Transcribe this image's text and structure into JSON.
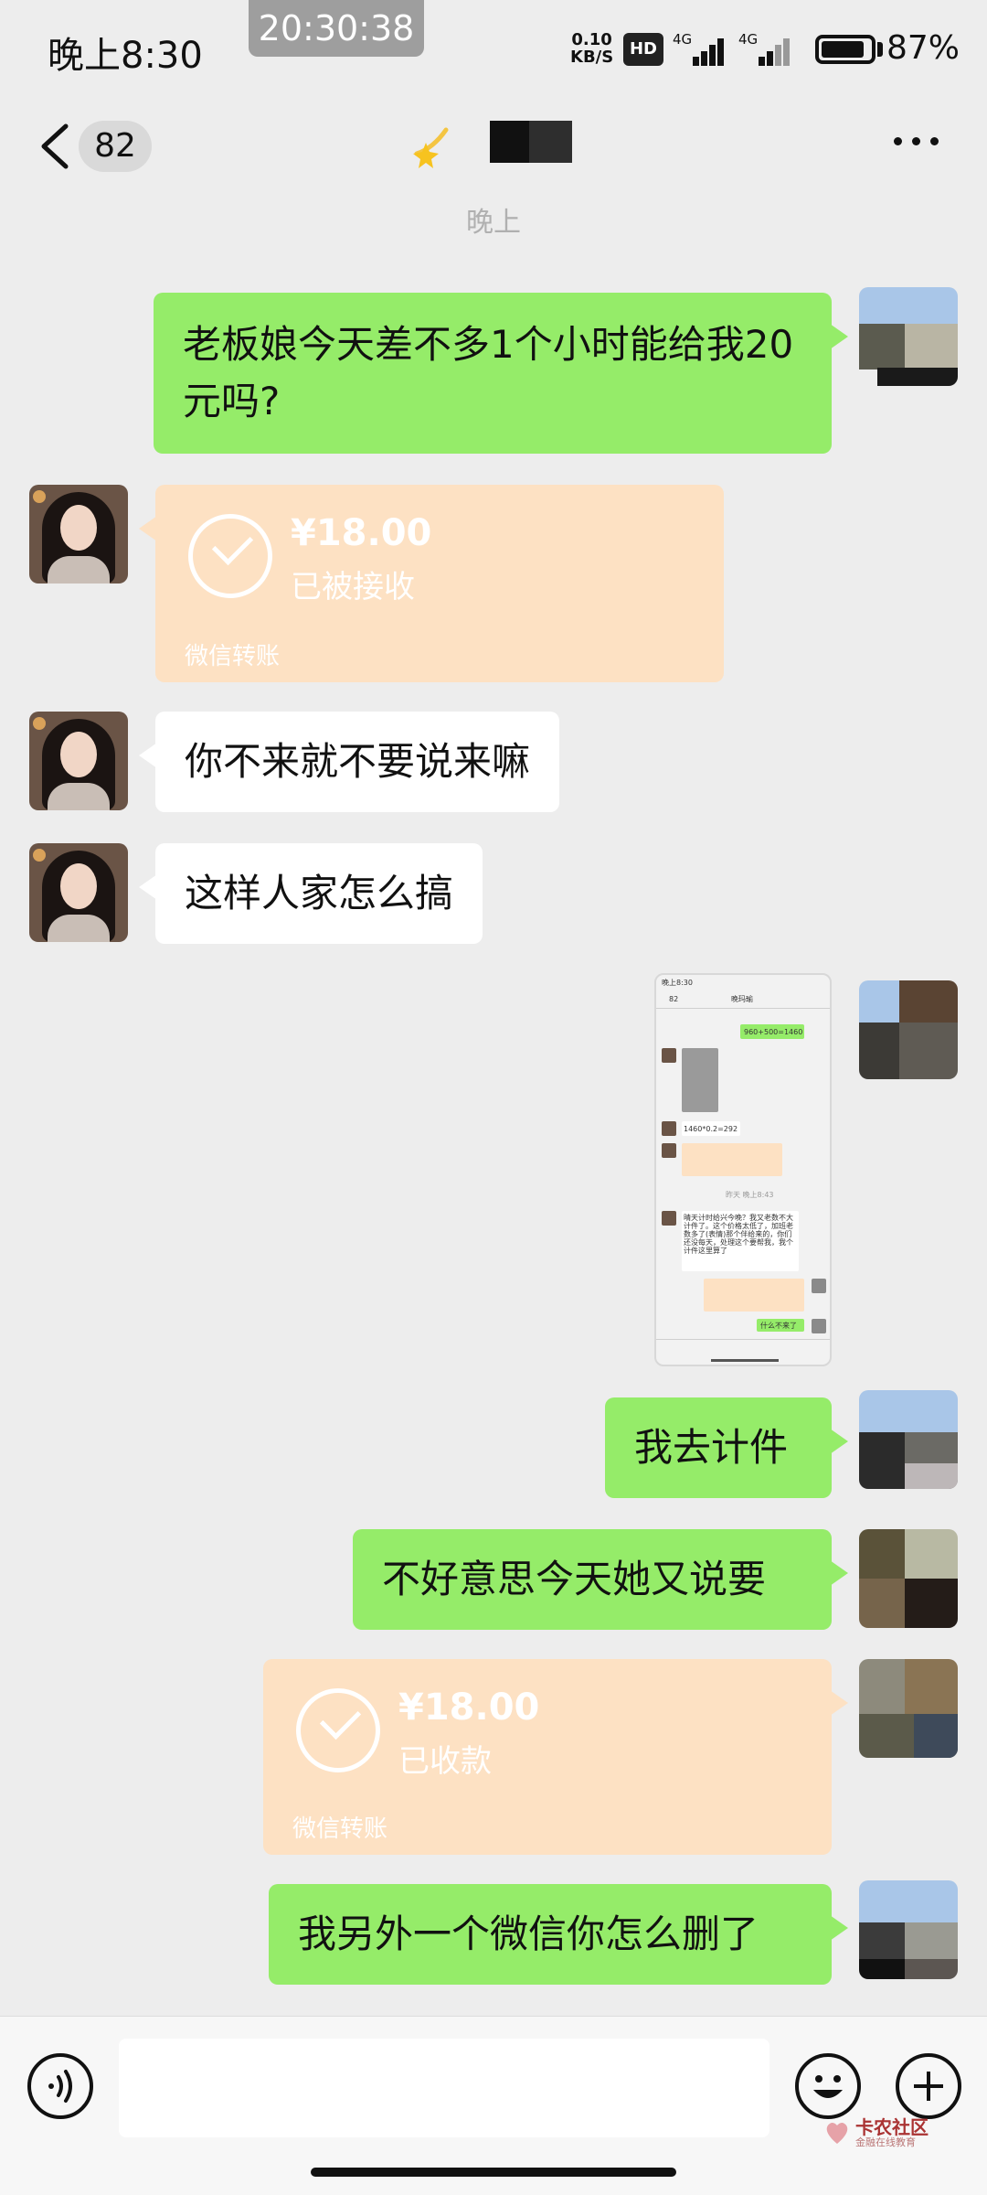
{
  "status_bar": {
    "time": "晚上8:30",
    "record_time": "20:30:38",
    "net_speed_value": "0.10",
    "net_speed_unit": "KB/S",
    "hd": "HD",
    "signal_1": "4G",
    "signal_2": "4G",
    "battery": "87%"
  },
  "nav": {
    "unread_count": "82",
    "contact_name": "",
    "more": "···"
  },
  "time_separator": "晚上",
  "messages": {
    "m1": "老板娘今天差不多1个小时能给我20元吗?",
    "m2": {
      "amount": "¥18.00",
      "status": "已被接收",
      "label": "微信转账"
    },
    "m3": "你不来就不要说来嘛",
    "m4": "这样人家怎么搞",
    "m6": "我去计件",
    "m7": "不好意思今天她又说要",
    "m8": {
      "amount": "¥18.00",
      "status": "已收款",
      "label": "微信转账"
    },
    "m9": "我另外一个微信你怎么删了"
  },
  "thumbnail": {
    "status_time": "晚上8:30",
    "back": "82",
    "title": "晚玛瑜",
    "green_1": "960+500=1460",
    "white_1": "1460*0.2=292",
    "time_mid": "昨天 晚上8:43",
    "long_text": "晴天计时给兴今晚？我又老数不大计件了。这个价格太低了，加班老数多了(表情)那个伴给来的，你们还没每天，处理这个要帮我，我个计件这里算了",
    "green_2": "什么不来了"
  },
  "input_bar": {
    "placeholder": ""
  },
  "watermark": {
    "title": "卡农社区",
    "subtitle": "金融在线教育"
  },
  "colors": {
    "background": "#ededed",
    "bubble_out": "#95ec69",
    "bubble_in": "#ffffff",
    "transfer": "#fde1c3"
  }
}
